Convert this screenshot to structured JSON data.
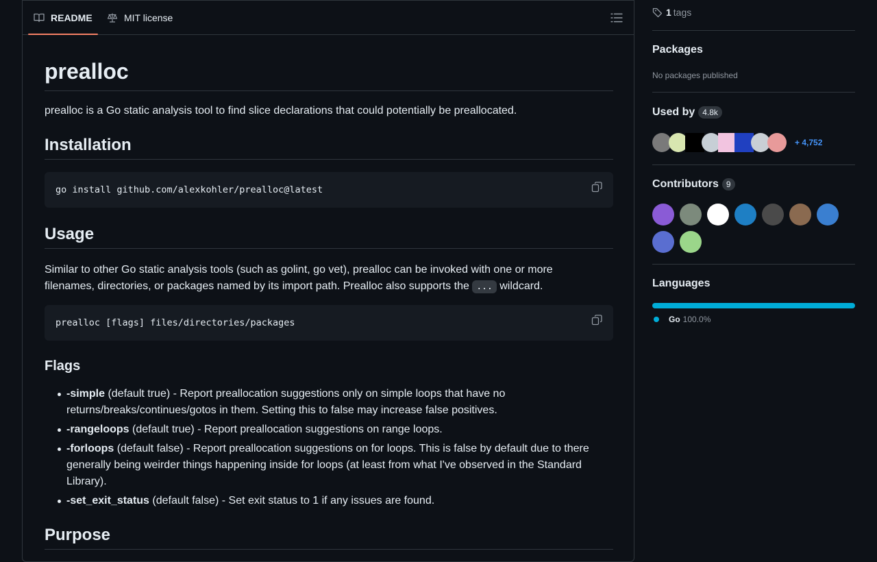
{
  "tabs": {
    "readme": "README",
    "license": "MIT license"
  },
  "readme": {
    "title": "prealloc",
    "intro": "prealloc is a Go static analysis tool to find slice declarations that could potentially be preallocated.",
    "installation_heading": "Installation",
    "install_cmd": "go install github.com/alexkohler/prealloc@latest",
    "usage_heading": "Usage",
    "usage_text_1": "Similar to other Go static analysis tools (such as golint, go vet), prealloc can be invoked with one or more",
    "usage_text_2": "filenames, directories, or packages named by its import path. Prealloc also supports the",
    "usage_inline_code": "...",
    "usage_text_3": "wildcard.",
    "usage_cmd": "prealloc [flags] files/directories/packages",
    "flags_heading": "Flags",
    "flags": [
      {
        "name": "-simple",
        "desc": " (default true) - Report preallocation suggestions only on simple loops that have no returns/breaks/continues/gotos in them. Setting this to false may increase false positives."
      },
      {
        "name": "-rangeloops",
        "desc": " (default true) - Report preallocation suggestions on range loops."
      },
      {
        "name": "-forloops",
        "desc": " (default false) - Report preallocation suggestions on for loops. This is false by default due to there generally being weirder things happening inside for loops (at least from what I've observed in the Standard Library)."
      },
      {
        "name": "-set_exit_status",
        "desc": " (default false) - Set exit status to 1 if any issues are found."
      }
    ],
    "purpose_heading": "Purpose"
  },
  "sidebar": {
    "tags_count": "1",
    "tags_label": "tags",
    "packages_heading": "Packages",
    "packages_text": "No packages published",
    "used_by_heading": "Used by",
    "used_by_count": "4.8k",
    "used_by_more": "+ 4,752",
    "contributors_heading": "Contributors",
    "contributors_count": "9",
    "languages_heading": "Languages",
    "language_name": "Go",
    "language_percent": "100.0%",
    "colors": {
      "accent": "#f78166",
      "go": "#00add8",
      "link": "#4493f8"
    }
  }
}
